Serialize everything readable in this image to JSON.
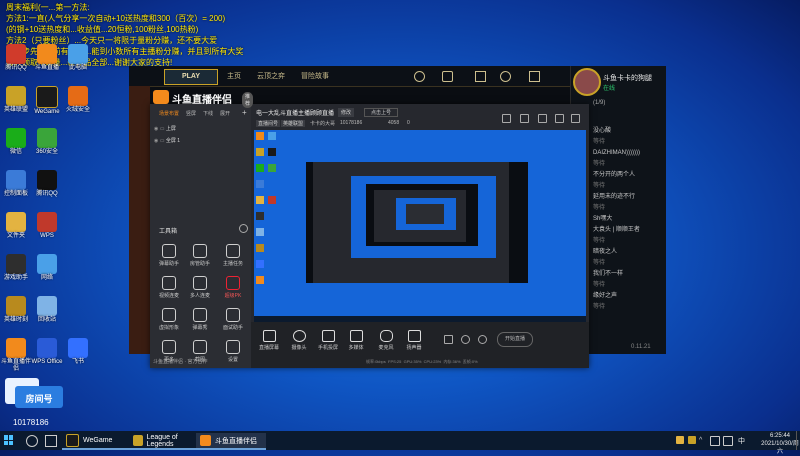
{
  "overlay": {
    "lines": [
      "周末福利(一...第一方法:",
      "方法1:一直(人气分享一次自动+10送热度和300（百次）= 200)",
      "(的钢+10送热度和...收益值...20恒粉,100粉丝,100热粉)",
      "方法2（只要粉丝）...今天只一将限于量粉分赚，还不要大爱",
      "第一步先...当前有粉丝...能到小数所有主播粉分赚，并且到所有大奖",
      "每天领取...数量...新作品全部...谢谢大家的支持!"
    ],
    "room_label": "房间号",
    "room_number": "10178186"
  },
  "desktop_icons": [
    {
      "label": "腾讯QQ",
      "color": "#d03b2b"
    },
    {
      "label": "斗鱼直播",
      "color": "#f28a1c"
    },
    {
      "label": "此电脑",
      "color": "#4aa0e8"
    },
    {
      "label": "英雄联盟",
      "color": "#c9a227"
    },
    {
      "label": "WeGame",
      "color": "#1a1a1a"
    },
    {
      "label": "火绒安全",
      "color": "#e56b16"
    },
    {
      "label": "微信",
      "color": "#1aad19"
    },
    {
      "label": "360安全",
      "color": "#3aa53a"
    },
    {
      "label": "控制面板",
      "color": "#3b7bd8"
    },
    {
      "label": "腾讯QQ",
      "color": "#111111"
    },
    {
      "label": "文件夹",
      "color": "#e3b341"
    },
    {
      "label": "WPS",
      "color": "#c0392b"
    },
    {
      "label": "游戏助手",
      "color": "#2e2e2e"
    },
    {
      "label": "网络",
      "color": "#4aa0e8"
    },
    {
      "label": "英雄时刻",
      "color": "#b88a1e"
    },
    {
      "label": "回收站",
      "color": "#7fb3e6"
    },
    {
      "label": "斗鱼直播伴侣",
      "color": "#f28a1c"
    },
    {
      "label": "WPS Office",
      "color": "#2a5bd7"
    },
    {
      "label": "飞书",
      "color": "#3370ff"
    }
  ],
  "lol_client": {
    "play_label": "PLAY",
    "nav": [
      "主页",
      "云顶之弈",
      "冒险故事"
    ],
    "profile_name": "斗鱼卡卡的狗腿",
    "profile_status": "在线",
    "chat_items": [
      "(1/9)",
      "没心酸",
      "等待",
      "DAIZHIMAN)))))))",
      "等待",
      "不分开的两个人",
      "等待",
      "延用未的迹不行",
      "等待",
      "Sh嘿大",
      "大袁头 | 顺顺王者",
      "等待",
      "暗夜之人",
      "等待",
      "我们不一样",
      "等待",
      "缘好之声",
      "等待"
    ],
    "footer_version": "0.11.21"
  },
  "streamer": {
    "title": "斗鱼直播伴侣",
    "badge": "推荐",
    "stream_title": "电一大乱斗直播主播顾顾直播",
    "modify_label": "修改",
    "category_label": "点击上号",
    "room_tag": "直播间号",
    "room_tag2": "英雄联盟",
    "room_info": "卡卡的大哥",
    "viewers": "10178186",
    "likes": "4058",
    "gifts": "0",
    "scene_tabs": [
      "场景布置",
      "竖屏",
      "下线",
      "展开"
    ],
    "scenes": [
      "上屏",
      "全屏 1"
    ],
    "tools_label": "工具箱",
    "tools": [
      "弹幕助手",
      "房管助手",
      "主播任务",
      "视频连麦",
      "多人连麦",
      "超级PK",
      "虚拟形象",
      "弹幕秀",
      "面试助手",
      "更多",
      "截图",
      "设置"
    ],
    "footer_items": [
      "斗鱼直播伴侣",
      "官方合作"
    ],
    "bottom_buttons": [
      "直播屏幕",
      "摄像头",
      "手机投屏",
      "多媒体",
      "麦克风",
      "扬声器"
    ],
    "start_label": "开始直播",
    "stats": [
      "帧率:0kbps",
      "FPS:25",
      "GPU:35%",
      "CPU:23%",
      "内存:36%",
      "丢帧:0%"
    ]
  },
  "taskbar": {
    "items": [
      {
        "label": "WeGame",
        "color": "#1a1a1a"
      },
      {
        "label": "League of Legends",
        "color": "#c9a227"
      },
      {
        "label": "斗鱼直播伴侣",
        "color": "#f28a1c"
      }
    ],
    "time": "6:25:44",
    "date": "2021/10/30/周六",
    "lang": "中"
  }
}
